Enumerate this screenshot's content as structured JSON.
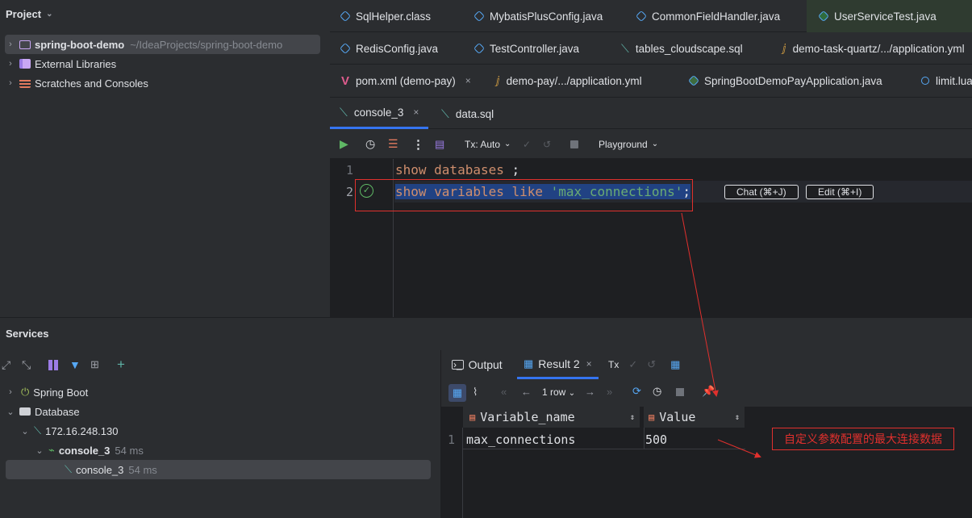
{
  "project": {
    "title": "Project",
    "tree": [
      {
        "name": "spring-boot-demo",
        "path": "~/IdeaProjects/spring-boot-demo"
      },
      {
        "name": "External Libraries"
      },
      {
        "name": "Scratches and Consoles"
      }
    ]
  },
  "editor_tabs": {
    "row1": [
      "SqlHelper.class",
      "MybatisPlusConfig.java",
      "CommonFieldHandler.java",
      "UserServiceTest.java"
    ],
    "row2": [
      "RedisConfig.java",
      "TestController.java",
      "tables_cloudscape.sql",
      "demo-task-quartz/.../application.yml"
    ],
    "row3": [
      "pom.xml (demo-pay)",
      "demo-pay/.../application.yml",
      "SpringBootDemoPayApplication.java",
      "limit.lua"
    ],
    "row4": [
      "console_3",
      "data.sql"
    ],
    "close_glyph": "×"
  },
  "toolbar": {
    "tx": "Tx: Auto",
    "playground": "Playground"
  },
  "code": {
    "line_numbers": [
      "1",
      "2"
    ],
    "line1_kw": "show databases",
    "line1_rest": " ;",
    "line2_kw": "show variables like ",
    "line2_str": "'max_connections'",
    "line2_rest": ";"
  },
  "inline_actions": {
    "chat": "Chat (⌘+J)",
    "edit": "Edit (⌘+I)"
  },
  "services": {
    "title": "Services",
    "tree": [
      {
        "name": "Spring Boot"
      },
      {
        "name": "Database"
      },
      {
        "name": "172.16.248.130"
      },
      {
        "name": "console_3",
        "time": "54 ms"
      },
      {
        "name": "console_3",
        "time": "54 ms"
      }
    ]
  },
  "result_tabs": {
    "output": "Output",
    "result": "Result 2",
    "tx": "Tx"
  },
  "result_toolbar": {
    "rows": "1 row"
  },
  "table": {
    "columns": [
      "Variable_name",
      "Value"
    ],
    "rows": [
      [
        "1",
        "max_connections",
        "500"
      ]
    ]
  },
  "annotation": {
    "text": "自定义参数配置的最大连接数据",
    "color": "#e0302d"
  }
}
